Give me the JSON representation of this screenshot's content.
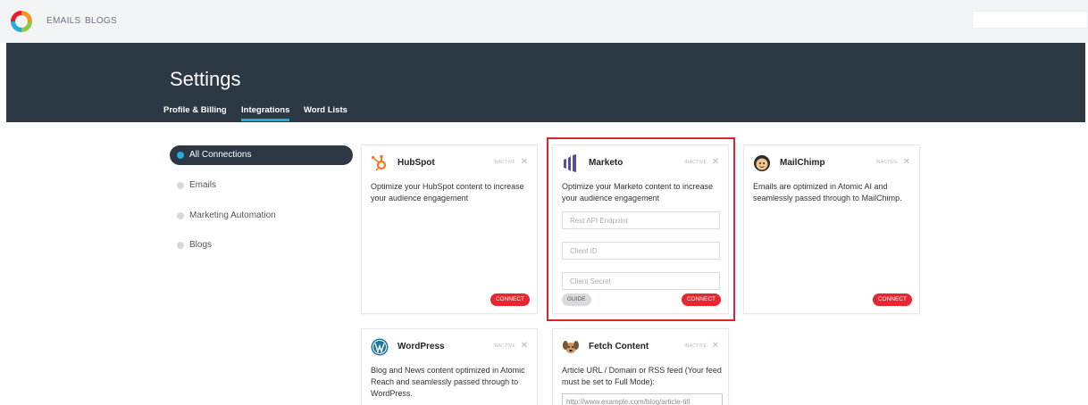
{
  "nav": {
    "emails": "EMAILS",
    "blogs": "BLOGS"
  },
  "header": {
    "title": "Settings",
    "tabs": [
      "Profile & Billing",
      "Integrations",
      "Word Lists"
    ],
    "active_tab": "Integrations"
  },
  "sidebar": {
    "items": [
      {
        "label": "All Connections",
        "active": true
      },
      {
        "label": "Emails",
        "active": false
      },
      {
        "label": "Marketing Automation",
        "active": false
      },
      {
        "label": "Blogs",
        "active": false
      }
    ]
  },
  "cards": {
    "hubspot": {
      "title": "HubSpot",
      "status": "INACTIVE",
      "close": "✕",
      "description": "Optimize your HubSpot content to increase your audience engagement",
      "connect": "CONNECT",
      "logo_icon": "hubspot-sprocket-icon"
    },
    "marketo": {
      "title": "Marketo",
      "status": "INACTIVE",
      "close": "✕",
      "description": "Optimize your Marketo content to increase your audience engagement",
      "fields": [
        "Rest API Endpoint",
        "Client ID",
        "Client Secret"
      ],
      "guide": "GUIDE",
      "connect": "CONNECT",
      "logo_icon": "marketo-bars-icon"
    },
    "mailchimp": {
      "title": "MailChimp",
      "status": "INACTIVE",
      "close": "✕",
      "description": "Emails are optimized in Atomic AI and seamlessly passed through to MailChimp.",
      "connect": "CONNECT",
      "logo_icon": "mailchimp-freddie-icon"
    },
    "wordpress": {
      "title": "WordPress",
      "status": "INACTIVE",
      "close": "✕",
      "description": "Blog and News content optimized in Atomic Reach and seamlessly passed through to WordPress.",
      "logo_icon": "wordpress-icon"
    },
    "fetch": {
      "title": "Fetch Content",
      "status": "INACTIVE",
      "close": "✕",
      "description": "Article URL / Domain or RSS feed (Your feed must be set to Full Mode):",
      "url_value": "http://www.example.com/blog/article-titl",
      "logo_icon": "fetch-dog-icon"
    }
  },
  "colors": {
    "header_bg": "#2c3944",
    "accent": "#27aae1",
    "connect_red": "#e8262f",
    "highlight_red": "#d9252b"
  }
}
